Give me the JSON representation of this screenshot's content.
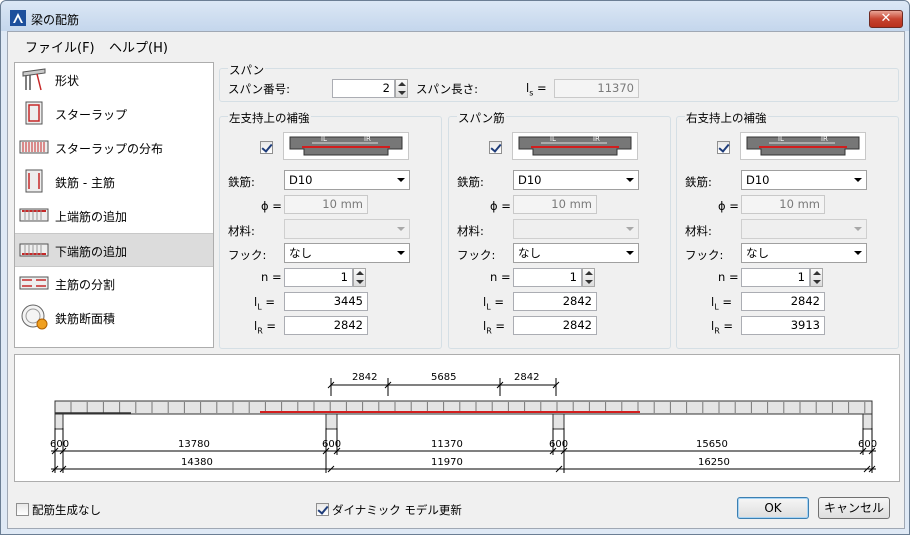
{
  "window": {
    "title": "梁の配筋",
    "close_glyph": "✕"
  },
  "menu": [
    {
      "label": "ファイル(F)"
    },
    {
      "label": "ヘルプ(H)"
    }
  ],
  "sidebar": {
    "items": [
      {
        "label": "形状",
        "icon": "shape-icon"
      },
      {
        "label": "スターラップ",
        "icon": "stirrup-icon"
      },
      {
        "label": "スターラップの分布",
        "icon": "stirrup-distribution-icon"
      },
      {
        "label": "鉄筋 - 主筋",
        "icon": "main-rebar-icon"
      },
      {
        "label": "上端筋の追加",
        "icon": "top-rebar-icon"
      },
      {
        "label": "下端筋の追加",
        "icon": "bottom-rebar-icon",
        "selected": true
      },
      {
        "label": "主筋の分割",
        "icon": "rebar-split-icon"
      },
      {
        "label": "鉄筋断面積",
        "icon": "rebar-area-icon"
      }
    ]
  },
  "span": {
    "group_label": "スパン",
    "number_label": "スパン番号:",
    "number_value": "2",
    "length_label": "スパン長さ:",
    "length_symbol": "l",
    "length_symbol_sub": "s",
    "equals": "=",
    "length_value": "11370"
  },
  "panels": [
    {
      "title": "左支持上の補強",
      "checked": true,
      "rebar_label": "鉄筋:",
      "rebar_value": "D10",
      "phi_label": "ϕ =",
      "phi_value": "10 mm",
      "material_label": "材料:",
      "material_value": "",
      "hook_label": "フック:",
      "hook_value": "なし",
      "n_label": "n =",
      "n_value": "1",
      "lL_label": "l",
      "lL_sub": "L",
      "lL_eq": "=",
      "lL_value": "3445",
      "lR_label": "l",
      "lR_sub": "R",
      "lR_eq": "=",
      "lR_value": "2842",
      "diag_l": "lL",
      "diag_r": "lR"
    },
    {
      "title": "スパン筋",
      "checked": true,
      "rebar_label": "鉄筋:",
      "rebar_value": "D10",
      "phi_label": "ϕ =",
      "phi_value": "10 mm",
      "material_label": "材料:",
      "material_value": "",
      "hook_label": "フック:",
      "hook_value": "なし",
      "n_label": "n =",
      "n_value": "1",
      "lL_label": "l",
      "lL_sub": "L",
      "lL_eq": "=",
      "lL_value": "2842",
      "lR_label": "l",
      "lR_sub": "R",
      "lR_eq": "=",
      "lR_value": "2842",
      "diag_l": "lL",
      "diag_r": "lR"
    },
    {
      "title": "右支持上の補強",
      "checked": true,
      "rebar_label": "鉄筋:",
      "rebar_value": "D10",
      "phi_label": "ϕ =",
      "phi_value": "10 mm",
      "material_label": "材料:",
      "material_value": "",
      "hook_label": "フック:",
      "hook_value": "なし",
      "n_label": "n =",
      "n_value": "1",
      "lL_label": "l",
      "lL_sub": "L",
      "lL_eq": "=",
      "lL_value": "2842",
      "lR_label": "l",
      "lR_sub": "R",
      "lR_eq": "=",
      "lR_value": "3913",
      "diag_l": "lL",
      "diag_r": "lR"
    }
  ],
  "beam": {
    "top_dims": [
      "2842",
      "5685",
      "2842"
    ],
    "support_widths": [
      "600",
      "600",
      "600",
      "600"
    ],
    "clear_spans": [
      "13780",
      "11370",
      "15650"
    ],
    "total_spans": [
      "14380",
      "11970",
      "16250"
    ],
    "rebar_color": "#d21e1e"
  },
  "footer": {
    "no_rebar_label": "配筋生成なし",
    "no_rebar_checked": false,
    "dynamic_label": "ダイナミック モデル更新",
    "dynamic_checked": true,
    "ok_label": "OK",
    "cancel_label": "キャンセル"
  }
}
